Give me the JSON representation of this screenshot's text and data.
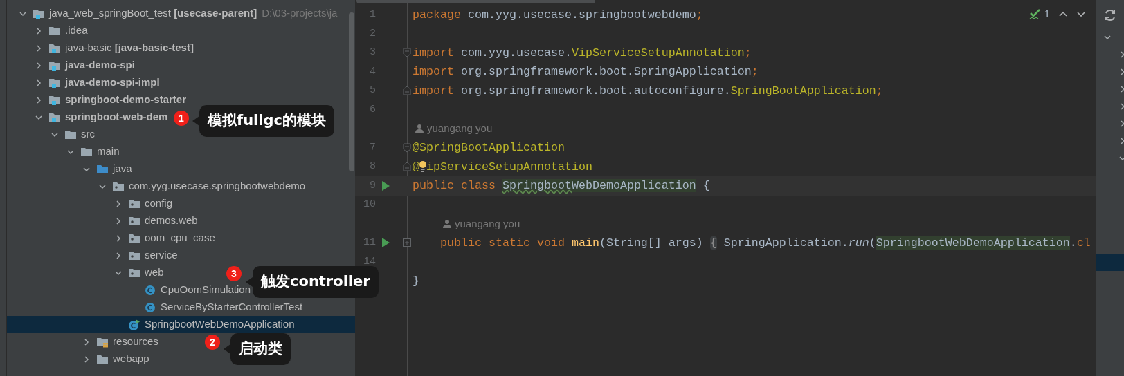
{
  "project_tree": {
    "items": [
      {
        "label": "java_web_springBoot_test **[usecase-parent]**",
        "path": "D:\\03-projects\\ja",
        "kind": "module",
        "expanded": true,
        "selected": false,
        "children": [
          {
            "label": ".idea",
            "kind": "folder",
            "expanded": false,
            "selected": false
          },
          {
            "label": "java-basic **[java-basic-test]**",
            "kind": "module",
            "expanded": false,
            "selected": false
          },
          {
            "label": "java-demo-spi",
            "kind": "module",
            "bold": true,
            "expanded": false,
            "selected": false
          },
          {
            "label": "java-demo-spi-impl",
            "kind": "module",
            "bold": true,
            "expanded": false,
            "selected": false
          },
          {
            "label": "springboot-demo-starter",
            "kind": "module",
            "bold": true,
            "expanded": false,
            "selected": false
          },
          {
            "label": "springboot-web-dem",
            "kind": "module",
            "bold": true,
            "expanded": true,
            "selected": false,
            "children": [
              {
                "label": "src",
                "kind": "folder",
                "expanded": true,
                "selected": false,
                "children": [
                  {
                    "label": "main",
                    "kind": "folder",
                    "expanded": true,
                    "selected": false,
                    "children": [
                      {
                        "label": "java",
                        "kind": "source_root",
                        "expanded": true,
                        "selected": false,
                        "children": [
                          {
                            "label": "com.yyg.usecase.springbootwebdemo",
                            "kind": "package",
                            "expanded": true,
                            "selected": false,
                            "children": [
                              {
                                "label": "config",
                                "kind": "package",
                                "expanded": false,
                                "selected": false
                              },
                              {
                                "label": "demos.web",
                                "kind": "package",
                                "expanded": false,
                                "selected": false
                              },
                              {
                                "label": "oom_cpu_case",
                                "kind": "package",
                                "expanded": false,
                                "selected": false
                              },
                              {
                                "label": "service",
                                "kind": "package",
                                "expanded": false,
                                "selected": false
                              },
                              {
                                "label": "web",
                                "kind": "package",
                                "expanded": true,
                                "selected": false,
                                "children": [
                                  {
                                    "label": "CpuOomSimulation",
                                    "kind": "class",
                                    "selected": false
                                  },
                                  {
                                    "label": "ServiceByStarterControllerTest",
                                    "kind": "class",
                                    "selected": false
                                  }
                                ]
                              },
                              {
                                "label": "SpringbootWebDemoApplication",
                                "kind": "app_class",
                                "selected": true
                              }
                            ]
                          }
                        ]
                      },
                      {
                        "label": "resources",
                        "kind": "resources_root",
                        "expanded": false,
                        "selected": false
                      },
                      {
                        "label": "webapp",
                        "kind": "folder",
                        "expanded": false,
                        "selected": false
                      }
                    ]
                  }
                ]
              }
            ]
          }
        ]
      }
    ]
  },
  "editor": {
    "inspection": {
      "count": "1"
    },
    "lines": [
      {
        "kind": "code",
        "number": "1",
        "tokens": [
          {
            "kind": "keyword",
            "text": "package"
          },
          {
            "kind": "plain",
            "text": " com.yyg.usecase.springbootwebdemo"
          },
          {
            "kind": "semicolon",
            "text": ";"
          }
        ]
      },
      {
        "kind": "code",
        "number": "2"
      },
      {
        "kind": "code",
        "number": "3",
        "fold": {
          "kind": "start"
        },
        "tokens": [
          {
            "kind": "keyword",
            "text": "import"
          },
          {
            "kind": "plain",
            "text": " com.yyg.usecase."
          },
          {
            "kind": "class",
            "text": "VipServiceSetupAnnotation"
          },
          {
            "kind": "semicolon",
            "text": ";"
          }
        ]
      },
      {
        "kind": "code",
        "number": "4",
        "tokens": [
          {
            "kind": "keyword",
            "text": "import"
          },
          {
            "kind": "plain",
            "text": " org.springframework.boot.SpringApplication"
          },
          {
            "kind": "semicolon",
            "text": ";"
          }
        ]
      },
      {
        "kind": "code",
        "number": "5",
        "fold": {
          "kind": "end"
        },
        "tokens": [
          {
            "kind": "keyword",
            "text": "import"
          },
          {
            "kind": "plain",
            "text": " org.springframework.boot.autoconfigure."
          },
          {
            "kind": "class",
            "text": "SpringBootApplication"
          },
          {
            "kind": "semicolon",
            "text": ";"
          }
        ]
      },
      {
        "kind": "code",
        "number": "6"
      },
      {
        "kind": "hint",
        "text": "yuangang you"
      },
      {
        "kind": "code",
        "number": "7",
        "fold": {
          "kind": "start"
        },
        "tokens": [
          {
            "kind": "annotation",
            "text": "@SpringBootApplication"
          }
        ]
      },
      {
        "kind": "code",
        "number": "8",
        "fold": {
          "kind": "end"
        },
        "tokens": [
          {
            "kind": "annotation",
            "text": "@"
          },
          {
            "kind": "bulb"
          },
          {
            "kind": "annotation",
            "text": "ipServiceSetupAnnotation"
          }
        ]
      },
      {
        "kind": "code",
        "number": "9",
        "runnable": true,
        "current": true,
        "tokens": [
          {
            "kind": "keyword",
            "text": "public class "
          },
          {
            "kind": "class_decl",
            "text": "Springboot",
            "typo": true
          },
          {
            "kind": "class_decl",
            "text": "WebDemoApplication"
          },
          {
            "kind": "plain",
            "text": " {"
          }
        ]
      },
      {
        "kind": "code",
        "number": "10"
      },
      {
        "kind": "hint",
        "text": "yuangang you"
      },
      {
        "kind": "code",
        "number": "11",
        "runnable": true,
        "fold": {
          "kind": "collapsed"
        },
        "tokens": [
          {
            "kind": "keyword",
            "text": "    public static void "
          },
          {
            "kind": "method",
            "text": "main"
          },
          {
            "kind": "plain",
            "text": "(String[] args) "
          },
          {
            "kind": "fold_chip",
            "text": "{"
          },
          {
            "kind": "plain",
            "text": " SpringApplication."
          },
          {
            "kind": "static_call",
            "text": "run"
          },
          {
            "kind": "plain",
            "text": "("
          },
          {
            "kind": "class_ref",
            "text": "SpringbootWebDemoApplication"
          },
          {
            "kind": "plain",
            "text": "."
          },
          {
            "kind": "keyword",
            "text": "cl"
          }
        ]
      },
      {
        "kind": "code",
        "number": "14"
      },
      {
        "kind": "code",
        "tokens": [
          {
            "kind": "plain",
            "text": "}"
          }
        ]
      }
    ]
  },
  "side_panel": {
    "rows": [
      {
        "expanded": true,
        "selected": false,
        "children": [
          {
            "expanded": false,
            "selected": false
          },
          {
            "expanded": false,
            "selected": false
          },
          {
            "expanded": false,
            "selected": false
          },
          {
            "expanded": false,
            "selected": false
          },
          {
            "expanded": false,
            "selected": false
          },
          {
            "expanded": false,
            "selected": false
          },
          {
            "expanded": true,
            "selected": false,
            "children": [
              {
                "selected": false
              },
              {
                "selected": false
              },
              {
                "selected": false
              },
              {
                "selected": false
              },
              {
                "selected": false
              },
              {
                "selected": true
              }
            ]
          }
        ]
      }
    ]
  },
  "callouts": [
    {
      "number": "1",
      "text": "模拟fullgc的模块"
    },
    {
      "number": "3",
      "text": "触发controller"
    },
    {
      "number": "2",
      "text": "启动类"
    }
  ]
}
